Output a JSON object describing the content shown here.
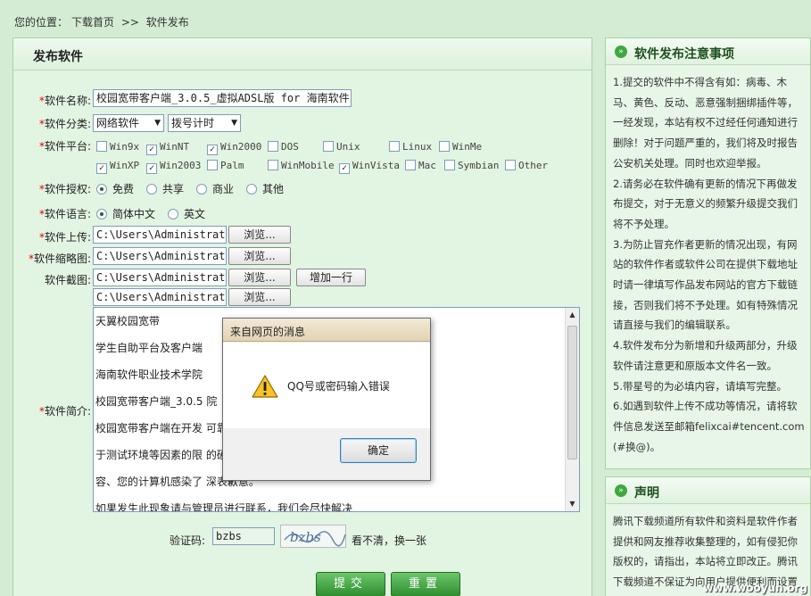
{
  "breadcrumb": {
    "prefix": "您的位置：",
    "home": "下载首页",
    "sep": ">>",
    "current": "软件发布"
  },
  "form": {
    "title": "发布软件",
    "name_label": "软件名称:",
    "name_value": "校园宽带客户端_3.0.5_虚拟ADSL版 for 海南软件",
    "category_label": "软件分类:",
    "category_value": "网络软件",
    "subcategory_value": "拨号计时",
    "platform_label": "软件平台:",
    "platforms": [
      {
        "label": "Win9x",
        "checked": false
      },
      {
        "label": "WinNT",
        "checked": true
      },
      {
        "label": "Win2000",
        "checked": true
      },
      {
        "label": "DOS",
        "checked": false
      },
      {
        "label": "Unix",
        "checked": false
      },
      {
        "label": "Linux",
        "checked": false
      },
      {
        "label": "WinMe",
        "checked": false
      },
      {
        "label": "WinXP",
        "checked": true
      },
      {
        "label": "Win2003",
        "checked": true
      },
      {
        "label": "Palm",
        "checked": false
      },
      {
        "label": "WinMobile",
        "checked": false
      },
      {
        "label": "WinVista",
        "checked": true
      },
      {
        "label": "Mac",
        "checked": false
      },
      {
        "label": "Symbian",
        "checked": false
      },
      {
        "label": "Other",
        "checked": false
      }
    ],
    "license_label": "软件授权:",
    "licenses": [
      "免费",
      "共享",
      "商业",
      "其他"
    ],
    "language_label": "软件语言:",
    "languages": [
      "简体中文",
      "英文"
    ],
    "upload_label": "软件上传:",
    "upload_value": "C:\\Users\\Administrato",
    "browse": "浏览...",
    "thumb_label": "软件缩略图:",
    "thumb_value": "C:\\Users\\Administrato",
    "shot_label": "软件截图:",
    "shot1_value": "C:\\Users\\Administrato",
    "shot2_value": "C:\\Users\\Administrato",
    "add_row": "增加一行",
    "intro_label": "软件简介:",
    "intro_lines": [
      "天翼校园宽带",
      "学生自助平台及客户端",
      "海南软件职业技术学院",
      "校园宽带客户端_3.0.5                        院",
      "校园宽带客户端在开发                         可靠性与稳定性。但由",
      "于测试环境等因素的限                         的硬件配置与软件不兼",
      "容、您的计算机感染了                         深表歉意。",
      "如果发生此现象请与管理员进行联系，我们会尽快解决"
    ],
    "captcha_label": "验证码:",
    "captcha_value": "bzbs",
    "captcha_image_text": "bzbs",
    "captcha_refresh": "看不清，换一张",
    "submit": "提交",
    "reset": "重置"
  },
  "notice": {
    "title": "软件发布注意事项",
    "lines": [
      "1.提交的软件中不得含有如：病毒、木",
      "马、黄色、反动、恶意强制捆绑插件等，",
      "一经发现，本站有权不过经任何通知进行",
      "删除！对于问题严重的，我们将及时报告",
      "公安机关处理。同时也欢迎举报。",
      "2.请务必在软件确有更新的情况下再做发",
      "布提交，对于无意义的频繁升级提交我们",
      "将不予处理。",
      "3.为防止冒充作者更新的情况出现，有网",
      "站的软件作者或软件公司在提供下载地址",
      "时请一律填写作品发布网站的官方下载链",
      "接，否则我们将不予处理。如有特殊情况",
      "请直接与我们的编辑联系。",
      "4.软件发布分为新增和升级两部分，升级",
      "软件请注意更和原版本文件名一致。",
      "5.带星号的为必填内容，请填写完整。",
      "6.如遇到软件上传不成功等情况，请将软",
      "件信息发送至邮箱felixcai#tencent.com",
      "(#换@)。"
    ]
  },
  "statement": {
    "title": "声明",
    "lines": [
      "腾讯下载频道所有软件和资料是软件作者",
      "提供和网友推荐收集整理的，如有侵犯你",
      "版权的，请指出，本站将立即改正。腾讯",
      "下载频道不保证为向用户提供便利而设置"
    ]
  },
  "dialog": {
    "title": "来自网页的消息",
    "message": "QQ号或密码输入错误",
    "ok": "确定"
  },
  "watermark": "www.wooyun.org"
}
